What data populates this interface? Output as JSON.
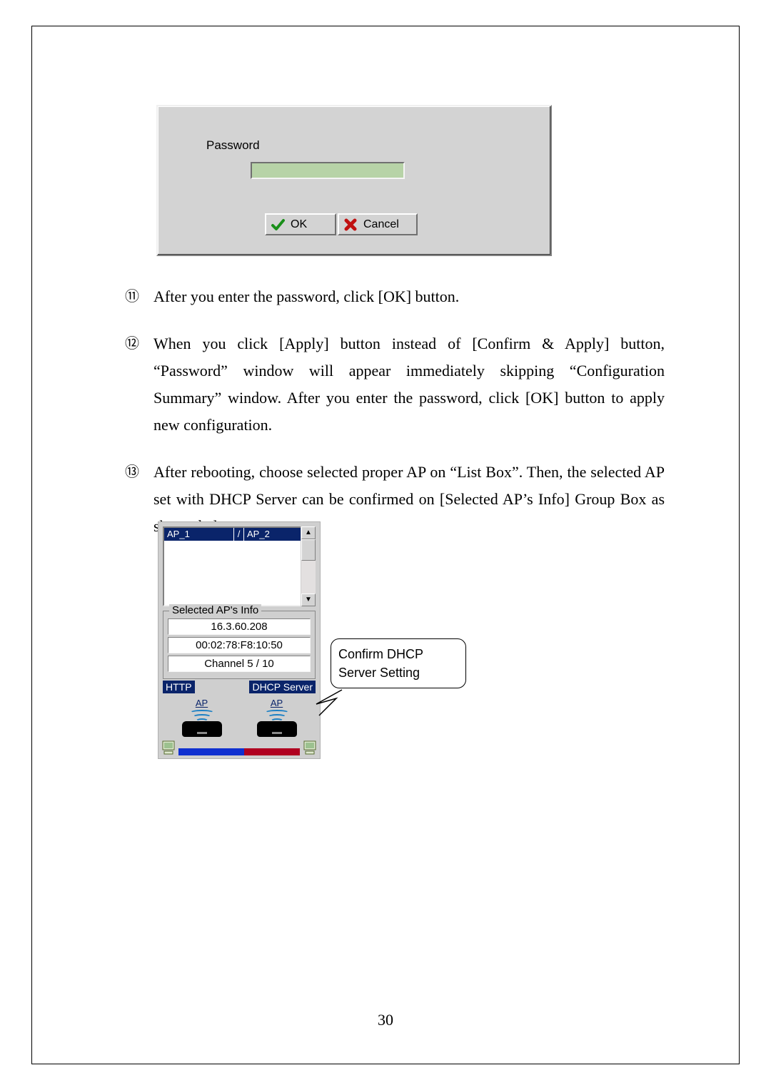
{
  "page_number": "30",
  "password_dialog": {
    "label": "Password",
    "ok_label": "OK",
    "cancel_label": "Cancel"
  },
  "steps": [
    {
      "marker": "⑪",
      "text": "After you enter the password, click [OK] button."
    },
    {
      "marker": "⑫",
      "text": "When you click [Apply] button instead of [Confirm & Apply] button, “Password” window will appear immediately skipping “Configuration Summary” window. After you enter the password, click [OK] button to apply new configuration."
    },
    {
      "marker": "⑬",
      "text": "After rebooting, choose selected proper AP on “List Box”. Then, the selected AP set with DHCP Server can be confirmed on [Selected AP’s Info] Group Box as shown below."
    }
  ],
  "ap_panel": {
    "list_items": [
      "AP_1",
      "AP_2"
    ],
    "group_title": "Selected AP's Info",
    "info_ip": "16.3.60.208",
    "info_mac": "00:02:78:F8:10:50",
    "info_channel": "Channel 5 / 10",
    "tag_http": "HTTP",
    "tag_dhcp": "DHCP Server",
    "ap_label": "AP"
  },
  "callout": {
    "line1": "Confirm DHCP",
    "line2": "Server Setting"
  }
}
